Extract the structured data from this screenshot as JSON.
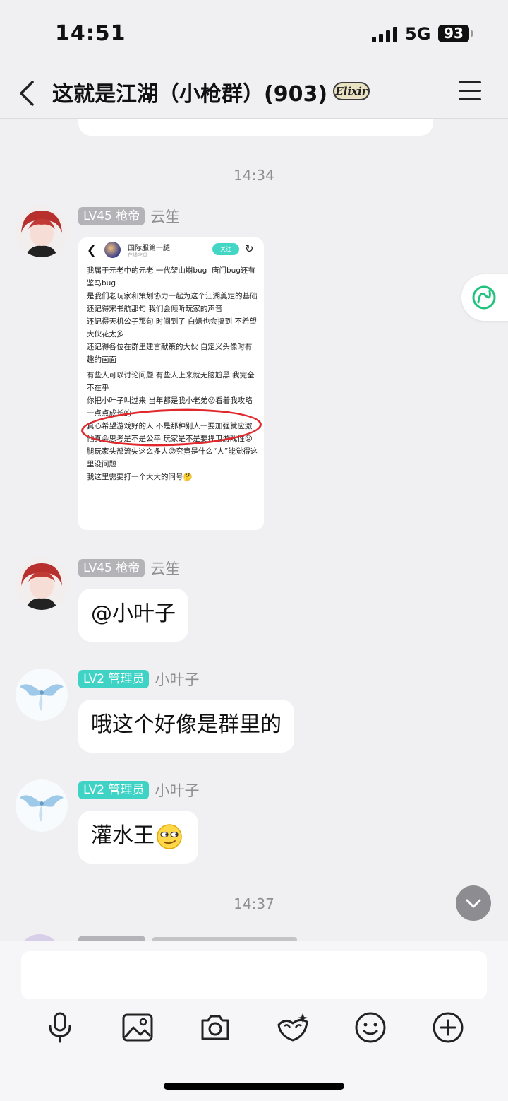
{
  "status_bar": {
    "time": "14:51",
    "network": "5G",
    "battery": "93"
  },
  "header": {
    "title": "这就是江湖（小枪群）(903)",
    "badge": "Elixir"
  },
  "messages": {
    "time1": "14:34",
    "time2": "14:37",
    "m1": {
      "level": "LV45 枪帝",
      "name": "云笙"
    },
    "m2": {
      "level": "LV45 枪帝",
      "name": "云笙",
      "text": "@小叶子"
    },
    "m3": {
      "level": "LV2 管理员",
      "name": "小叶子",
      "text": "哦这个好像是群里的"
    },
    "m4": {
      "level": "LV2 管理员",
      "name": "小叶子",
      "text": "灌水王"
    }
  },
  "screenshot": {
    "name": "国际服第一腿",
    "subtitle": "在线吃瓜",
    "follow": "关注",
    "lines": [
      "我属于元老中的元老 一代架山崩bug  唐门bug还有鉴马bug",
      "是我们老玩家和策划协力一起为这个江湖奠定的基础",
      "还记得宋书航那句 我们会倾听玩家的声音",
      "还记得天机公子那句 时间到了 白嫖也会搞到 不希望大伙花太多",
      "还记得各位在群里建言献策的大伙 自定义头像时有趣的画面",
      "有些人可以讨论问题 有些人上来就无脑尬黑 我完全不在乎",
      "你把小叶子叫过来 当年都是我小老弟😝看着我攻略一点点成长的",
      "真心希望游戏好的人 不是那种别人一要加强就应激",
      "他真会思考是不是公平 玩家是不是要捍卫游戏性😝",
      "腿玩家头部流失这么多人😝究竟是什么“人”能觉得这里没问题",
      "我这里需要打一个大大的问号🤔"
    ]
  },
  "toolbar": {
    "icons": [
      "microphone-icon",
      "image-icon",
      "camera-icon",
      "face-mask-icon",
      "emoji-icon",
      "plus-icon"
    ]
  },
  "colors": {
    "accent_teal": "#3fd3c6",
    "level_gray": "#b3b3b8",
    "annotation_red": "#e0282d"
  }
}
